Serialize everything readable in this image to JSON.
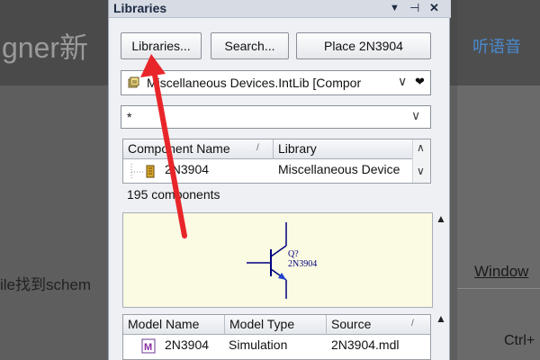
{
  "background": {
    "app_title": "gner新",
    "listen_label": "听语音",
    "left_text": "ile找到schem",
    "window_label": "Window",
    "shortcut_label": "Ctrl+"
  },
  "panel": {
    "title": "Libraries",
    "title_buttons": {
      "menu": "▼",
      "pin": "⊣",
      "close": "✕"
    },
    "buttons": {
      "libraries": "Libraries...",
      "search": "Search...",
      "place": "Place 2N3904"
    },
    "library_combo": {
      "value": "Miscellaneous Devices.IntLib [Compor",
      "icon": "library-icon",
      "chevron": "∨",
      "favorite": "❤"
    },
    "filter": {
      "value": "*",
      "chevron": "∨"
    },
    "component_grid": {
      "columns": [
        "Component Name",
        "Library"
      ],
      "sort_indicator": "/",
      "rows": [
        {
          "name": "2N3904",
          "library": "Miscellaneous Device"
        }
      ]
    },
    "component_count": "195 components",
    "preview": {
      "designator": "Q?",
      "part": "2N3904"
    },
    "model_grid": {
      "columns": [
        "Model Name",
        "Model Type",
        "Source"
      ],
      "sort_indicator": "/",
      "rows": [
        {
          "name": "2N3904",
          "type": "Simulation",
          "source": "2N3904.mdl"
        }
      ]
    },
    "collapse_glyph": "▲"
  },
  "colors": {
    "arrow": "#e8262a",
    "panel_bg": "#eef0f4",
    "preview_bg": "#fbfbe3",
    "schematic_line": "#000080",
    "transistor_arrow": "#2040d0"
  }
}
